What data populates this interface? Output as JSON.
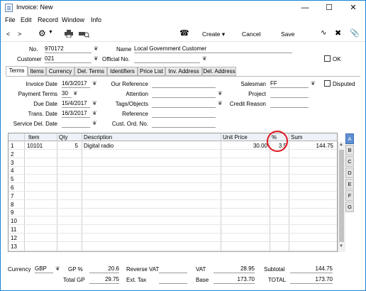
{
  "window": {
    "title": "Invoice: New"
  },
  "menu": [
    "File",
    "Edit",
    "Record",
    "Window",
    "Info"
  ],
  "toolbar": {
    "create": "Create",
    "cancel": "Cancel",
    "save": "Save"
  },
  "header": {
    "no_label": "No.",
    "no_value": "970172",
    "name_label": "Name",
    "name_value": "Local Government Customer",
    "customer_label": "Customer",
    "customer_value": "021",
    "official_label": "Official No.",
    "official_value": "",
    "ok_label": "OK"
  },
  "tabs": [
    "Terms",
    "Items",
    "Currency",
    "Del. Terms",
    "Identifiers",
    "Price List",
    "Inv. Address",
    "Del. Address"
  ],
  "terms": {
    "invoice_date_label": "Invoice Date",
    "invoice_date": "16/3/2017",
    "payment_terms_label": "Payment Terms",
    "payment_terms": "30",
    "due_date_label": "Due Date",
    "due_date": "15/4/2017",
    "trans_date_label": "Trans. Date",
    "trans_date": "16/3/2017",
    "service_del_label": "Service Del. Date",
    "service_del": "",
    "our_ref_label": "Our Reference",
    "our_ref": "",
    "attention_label": "Attention",
    "attention": "",
    "tags_label": "Tags/Objects",
    "tags": "",
    "reference_label": "Reference",
    "reference": "",
    "cust_ord_label": "Cust. Ord. No.",
    "cust_ord": "",
    "salesman_label": "Salesman",
    "salesman": "FF",
    "project_label": "Project",
    "project": "",
    "credit_reason_label": "Credit Reason",
    "credit_reason": "",
    "disputed_label": "Disputed"
  },
  "grid": {
    "columns": [
      "Item",
      "Qty",
      "Description",
      "Unit Price",
      "%",
      "Sum"
    ],
    "rows": [
      {
        "n": "1",
        "item": "10101",
        "qty": "5",
        "desc": "Digital radio",
        "price": "30.00",
        "pct": "3.5",
        "sum": "144.75"
      },
      {
        "n": "2"
      },
      {
        "n": "3"
      },
      {
        "n": "4"
      },
      {
        "n": "5"
      },
      {
        "n": "6"
      },
      {
        "n": "7"
      },
      {
        "n": "8"
      },
      {
        "n": "9"
      },
      {
        "n": "10"
      },
      {
        "n": "11"
      },
      {
        "n": "12"
      },
      {
        "n": "13"
      }
    ],
    "side_tabs": [
      "A",
      "B",
      "C",
      "D",
      "E",
      "F",
      "G"
    ]
  },
  "footer": {
    "currency_label": "Currency",
    "currency": "GBP",
    "gp_pct_label": "GP %",
    "gp_pct": "20.6",
    "total_gp_label": "Total GP",
    "total_gp": "29.75",
    "reverse_vat_label": "Reverse VAT",
    "reverse_vat": "",
    "ext_tax_label": "Ext. Tax",
    "ext_tax": "",
    "vat_label": "VAT",
    "vat": "28.95",
    "base_label": "Base",
    "base": "173.70",
    "subtotal_label": "Subtotal",
    "subtotal": "144.75",
    "total_label": "TOTAL",
    "total": "173.70"
  },
  "colors": {
    "accent": "#1883d7",
    "highlight_circle": "#e0141e",
    "side_active": "#5f8fd0"
  }
}
